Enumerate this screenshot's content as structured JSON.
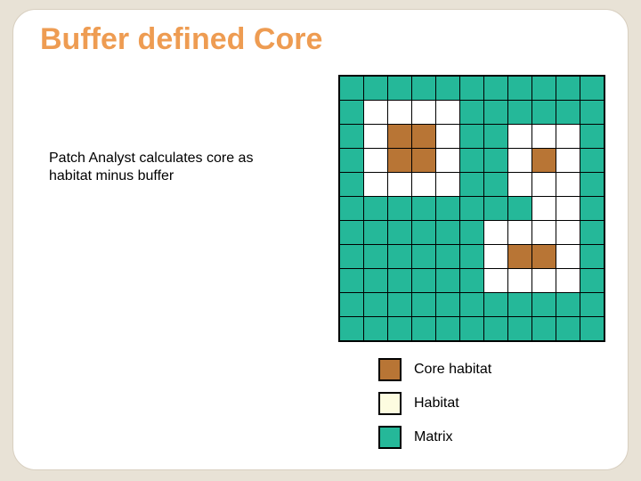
{
  "title": "Buffer defined Core",
  "description": "Patch Analyst calculates core as habitat minus buffer",
  "legend": {
    "core": "Core habitat",
    "habitat": "Habitat",
    "matrix": "Matrix"
  },
  "chart_data": {
    "type": "heatmap",
    "title": "Buffer defined Core",
    "rows": 11,
    "cols": 11,
    "categories": {
      "m": "Matrix",
      "h": "Habitat",
      "c": "Core"
    },
    "colors": {
      "m": "#25b899",
      "h": "#ffffff",
      "c": "#b87535"
    },
    "grid": [
      [
        "m",
        "m",
        "m",
        "m",
        "m",
        "m",
        "m",
        "m",
        "m",
        "m",
        "m"
      ],
      [
        "m",
        "h",
        "h",
        "h",
        "h",
        "m",
        "m",
        "m",
        "m",
        "m",
        "m"
      ],
      [
        "m",
        "h",
        "c",
        "c",
        "h",
        "m",
        "m",
        "h",
        "h",
        "h",
        "m"
      ],
      [
        "m",
        "h",
        "c",
        "c",
        "h",
        "m",
        "m",
        "h",
        "c",
        "h",
        "m"
      ],
      [
        "m",
        "h",
        "h",
        "h",
        "h",
        "m",
        "m",
        "h",
        "h",
        "h",
        "m"
      ],
      [
        "m",
        "m",
        "m",
        "m",
        "m",
        "m",
        "m",
        "m",
        "h",
        "h",
        "m"
      ],
      [
        "m",
        "m",
        "m",
        "m",
        "m",
        "m",
        "h",
        "h",
        "h",
        "h",
        "m"
      ],
      [
        "m",
        "m",
        "m",
        "m",
        "m",
        "m",
        "h",
        "c",
        "c",
        "h",
        "m"
      ],
      [
        "m",
        "m",
        "m",
        "m",
        "m",
        "m",
        "h",
        "h",
        "h",
        "h",
        "m"
      ],
      [
        "m",
        "m",
        "m",
        "m",
        "m",
        "m",
        "m",
        "m",
        "m",
        "m",
        "m"
      ],
      [
        "m",
        "m",
        "m",
        "m",
        "m",
        "m",
        "m",
        "m",
        "m",
        "m",
        "m"
      ]
    ]
  }
}
